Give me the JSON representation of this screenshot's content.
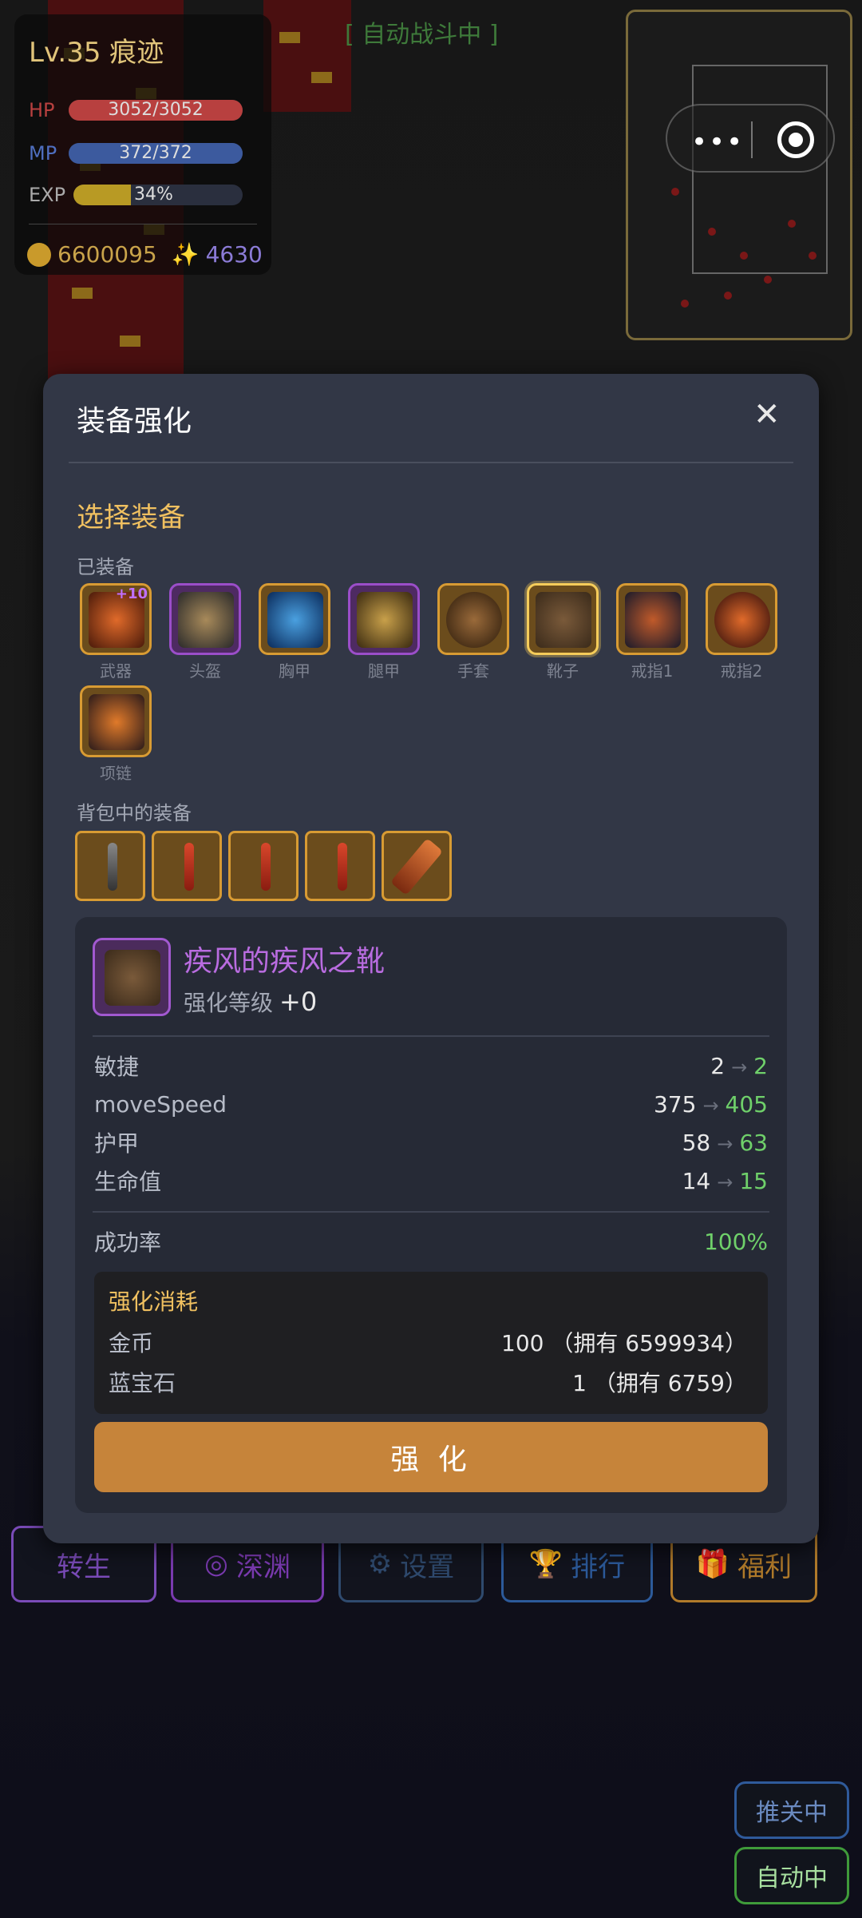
{
  "hud": {
    "level": "Lv.35 痕迹",
    "hp_label": "HP",
    "hp_text": "3052/3052",
    "hp_fill": 1.0,
    "mp_label": "MP",
    "mp_text": "372/372",
    "mp_fill": 1.0,
    "exp_label": "EXP",
    "exp_text": "34%",
    "exp_fill": 0.34,
    "gold": "6600095",
    "gems": "4630",
    "colors": {
      "hp": "#b8403f",
      "mp": "#3c5a9e",
      "exp": "#b89a24"
    }
  },
  "auto_battle": "[ 自动战斗中 ]",
  "modal": {
    "title": "装备强化",
    "close_icon": "close-icon",
    "section_title": "选择装备",
    "equipped_label": "已装备",
    "equipped": [
      {
        "label": "武器",
        "icon": "weapon-icon",
        "plus": "+10"
      },
      {
        "label": "头盔",
        "icon": "helmet-icon"
      },
      {
        "label": "胸甲",
        "icon": "chestplate-icon"
      },
      {
        "label": "腿甲",
        "icon": "greaves-icon"
      },
      {
        "label": "手套",
        "icon": "gloves-icon"
      },
      {
        "label": "靴子",
        "icon": "boots-icon"
      },
      {
        "label": "戒指1",
        "icon": "ring-icon"
      },
      {
        "label": "戒指2",
        "icon": "ring-icon"
      },
      {
        "label": "项链",
        "icon": "necklace-icon"
      }
    ],
    "bag_label": "背包中的装备",
    "bag_items": [
      "dagger-icon",
      "sword-icon",
      "sword-icon",
      "sword-icon",
      "greatsword-icon"
    ],
    "detail": {
      "item_name": "疾风的疾风之靴",
      "level_label": "强化等级",
      "level_value": "+0",
      "stats": [
        {
          "name": "敏捷",
          "old": "2",
          "new": "2"
        },
        {
          "name": "moveSpeed",
          "old": "375",
          "new": "405"
        },
        {
          "name": "护甲",
          "old": "58",
          "new": "63"
        },
        {
          "name": "生命值",
          "old": "14",
          "new": "15"
        }
      ],
      "arrow": "→",
      "success_label": "成功率",
      "success_value": "100%",
      "cost_title": "强化消耗",
      "cost": [
        {
          "name": "金币",
          "value": "100 （拥有 6599934）"
        },
        {
          "name": "蓝宝石",
          "value": "1 （拥有 6759）"
        }
      ],
      "button": "强 化"
    }
  },
  "bottom_bar": [
    {
      "label": "转生",
      "color": "#7a4bb8"
    },
    {
      "label": "深渊",
      "color": "#7a3ab0"
    },
    {
      "label": "设置",
      "color": "#2f4a6e"
    },
    {
      "label": "排行",
      "color": "#2c5a9a"
    },
    {
      "label": "福利",
      "color": "#b07a2a"
    }
  ],
  "corner": {
    "push": "推关中",
    "auto": "自动中"
  }
}
